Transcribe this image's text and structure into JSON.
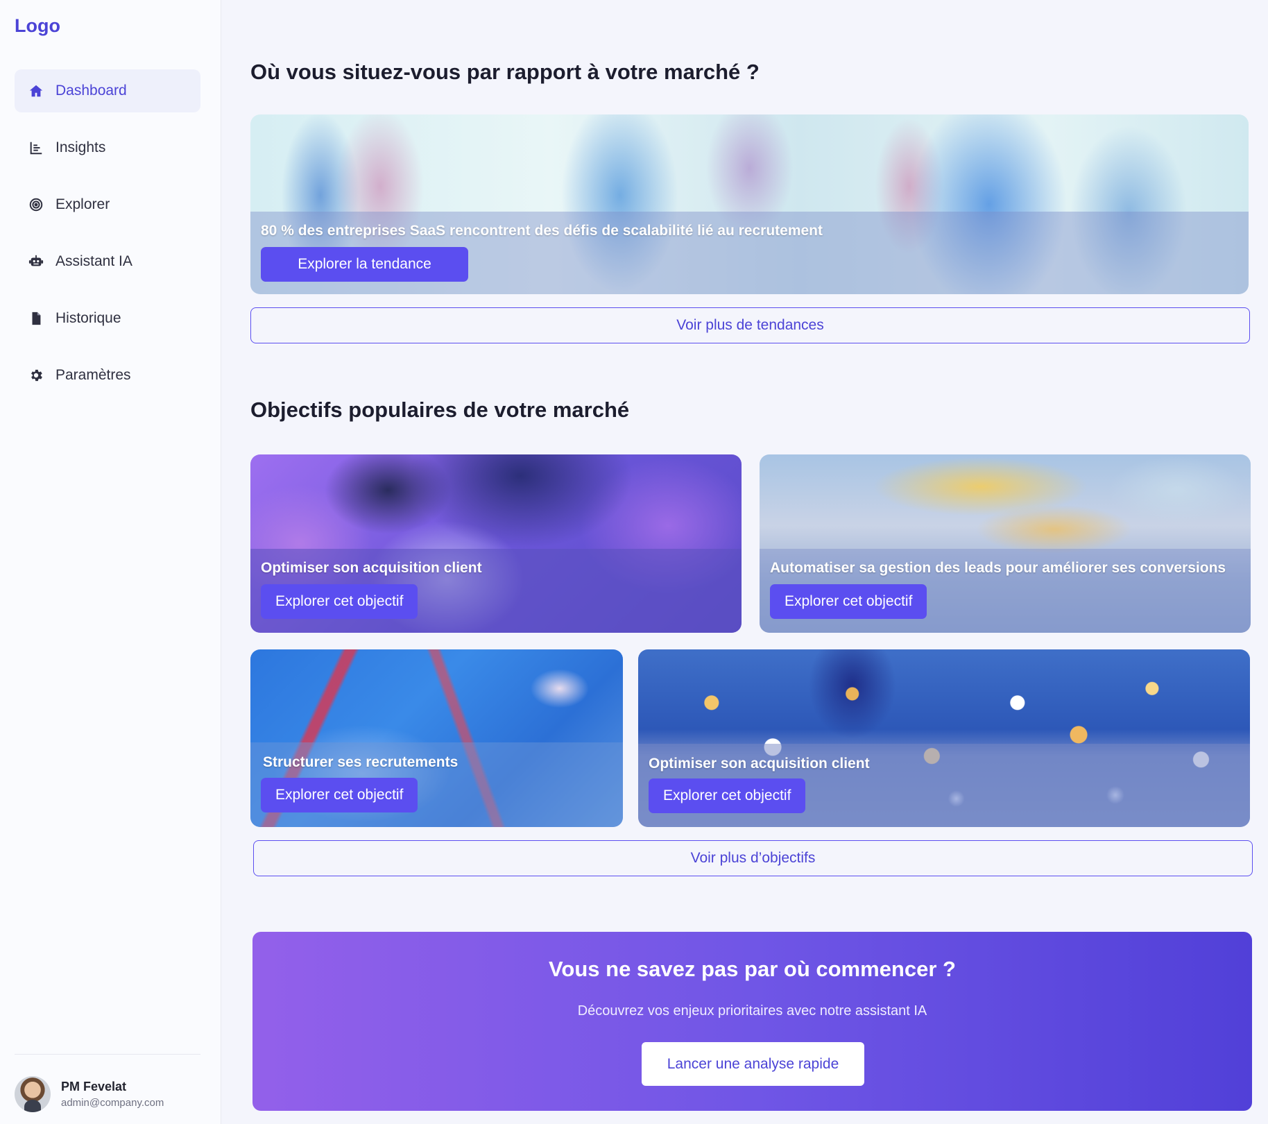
{
  "logo": "Logo",
  "sidebar": {
    "items": [
      {
        "label": "Dashboard",
        "icon": "home-icon"
      },
      {
        "label": "Insights",
        "icon": "chart-icon"
      },
      {
        "label": "Explorer",
        "icon": "target-icon"
      },
      {
        "label": "Assistant IA",
        "icon": "robot-icon"
      },
      {
        "label": "Historique",
        "icon": "file-icon"
      },
      {
        "label": "Paramètres",
        "icon": "gear-icon"
      }
    ],
    "active": "Dashboard"
  },
  "user": {
    "name": "PM Fevelat",
    "email": "admin@company.com"
  },
  "market": {
    "title": "Où vous situez-vous par rapport à votre marché ?",
    "trend": {
      "caption": "80 % des entreprises SaaS rencontrent des défis de scalabilité lié au recrutement",
      "button": "Explorer la tendance"
    },
    "more_button": "Voir plus de tendances"
  },
  "objectives": {
    "title": "Objectifs populaires de votre marché",
    "cards": [
      {
        "caption": "Optimiser son acquisition client",
        "button": "Explorer cet objectif"
      },
      {
        "caption": "Automatiser sa gestion des leads pour améliorer ses conversions",
        "button": "Explorer cet objectif"
      },
      {
        "caption": "Structurer ses recrutements",
        "button": "Explorer cet objectif"
      },
      {
        "caption": "Optimiser son acquisition client",
        "button": "Explorer cet objectif"
      }
    ],
    "more_button": "Voir plus d’objectifs"
  },
  "cta": {
    "title": "Vous ne savez pas par où commencer ?",
    "subtitle": "Découvrez vos enjeux prioritaires avec notre assistant IA",
    "button": "Lancer une analyse rapide"
  },
  "colors": {
    "accent": "#5b4ef0",
    "brand": "#4b43d6",
    "background": "#f4f5fc",
    "sidebar": "#fafbfe"
  }
}
